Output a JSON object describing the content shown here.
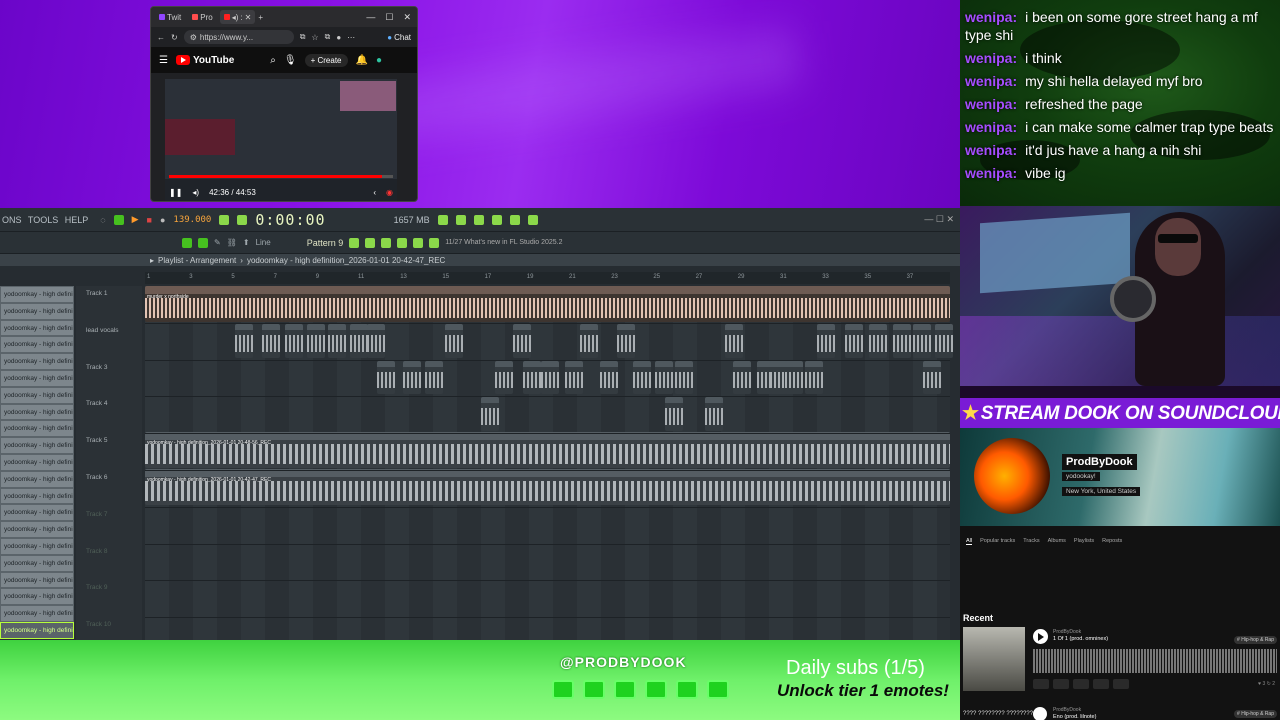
{
  "browser": {
    "tabs": [
      {
        "label": "Twit",
        "color": "#9146ff"
      },
      {
        "label": "Pro",
        "color": "#ff4d4d"
      },
      {
        "label": ":",
        "color": "#ff2020"
      }
    ],
    "url": "https://www.y...",
    "chat_label": "Chat",
    "yt_logo": "YouTube",
    "create_label": "Create",
    "video_time": "42:36 / 44:53",
    "video_progress": 0.95
  },
  "chat": {
    "messages": [
      {
        "user": "wenipa:",
        "text": "i been on some gore street hang a mf type shi"
      },
      {
        "user": "wenipa:",
        "text": "i think"
      },
      {
        "user": "wenipa:",
        "text": "my shi hella delayed myf bro"
      },
      {
        "user": "wenipa:",
        "text": "refreshed the page"
      },
      {
        "user": "wenipa:",
        "text": "i can make some calmer trap type beats"
      },
      {
        "user": "wenipa:",
        "text": "it'd jus have a hang a nih shi"
      },
      {
        "user": "wenipa:",
        "text": "vibe ig"
      }
    ]
  },
  "fl": {
    "menu": [
      "ONS",
      "TOOLS",
      "HELP"
    ],
    "tempo": "139.000",
    "time": "0:00:00",
    "pattern": "Pattern 9",
    "whats_new": "11/27  What's new in FL Studio 2025.2",
    "line_label": "Line",
    "memory": "1657 MB",
    "playlist_title": "Playlist - Arrangement",
    "playlist_file": "yodoomkay - high definition_2026-01-01 20-42-47_REC",
    "channel_label": "yodoomkay - high defini...",
    "channel_count": 21,
    "selected_channel": 20,
    "tracks": [
      {
        "label": "Track 1",
        "dim": false
      },
      {
        "label": "lead vocals",
        "dim": false
      },
      {
        "label": "Track 3",
        "dim": false
      },
      {
        "label": "Track 4",
        "dim": false
      },
      {
        "label": "Track 5",
        "dim": false
      },
      {
        "label": "Track 6",
        "dim": false
      },
      {
        "label": "Track 7",
        "dim": true
      },
      {
        "label": "Track 8",
        "dim": true
      },
      {
        "label": "Track 9",
        "dim": true
      },
      {
        "label": "Track 10",
        "dim": true
      }
    ],
    "clip_track1": "murder x northside",
    "clip_track1b": "murder x northside",
    "clip_track5": "yodoomkay - high definition_2026-01-01 20-48-56_REC",
    "clip_track6": "yodoomkay - high definition_2026-01-01 20-42-47_REC",
    "ruler_marks": [
      "1",
      "3",
      "5",
      "7",
      "9",
      "11",
      "13",
      "15",
      "17",
      "19",
      "21",
      "23",
      "25",
      "27",
      "29",
      "31",
      "33",
      "35",
      "37"
    ]
  },
  "soundcloud": {
    "banner": "STREAM DOOK ON SOUNDCLOUD",
    "name": "ProdByDook",
    "handle": "yodookay!",
    "location": "New York, United States",
    "tabs": [
      "All",
      "Popular tracks",
      "Tracks",
      "Albums",
      "Playlists",
      "Reposts"
    ],
    "recent_label": "Recent",
    "track1": {
      "artist": "ProdByDook",
      "title": "1 Of 1 (prod. omninex)",
      "tag": "# Hip-hop & Rap",
      "stats": "♥ 3   ↻ 2"
    },
    "track2": {
      "qs": "???? ???????? ????????",
      "artist": "ProdByDook",
      "title": "Eno (prod. lilnote)",
      "tag": "# Hip-hop & Rap"
    }
  },
  "overlay": {
    "handle": "@PRODBYDOOK",
    "daily_subs": "Daily subs (1/5)",
    "unlock": "Unlock tier 1 emotes!",
    "social_icons": [
      "youtube-icon",
      "twitch-icon",
      "tiktok-icon",
      "x-icon",
      "instagram-icon",
      "discord-icon"
    ]
  }
}
